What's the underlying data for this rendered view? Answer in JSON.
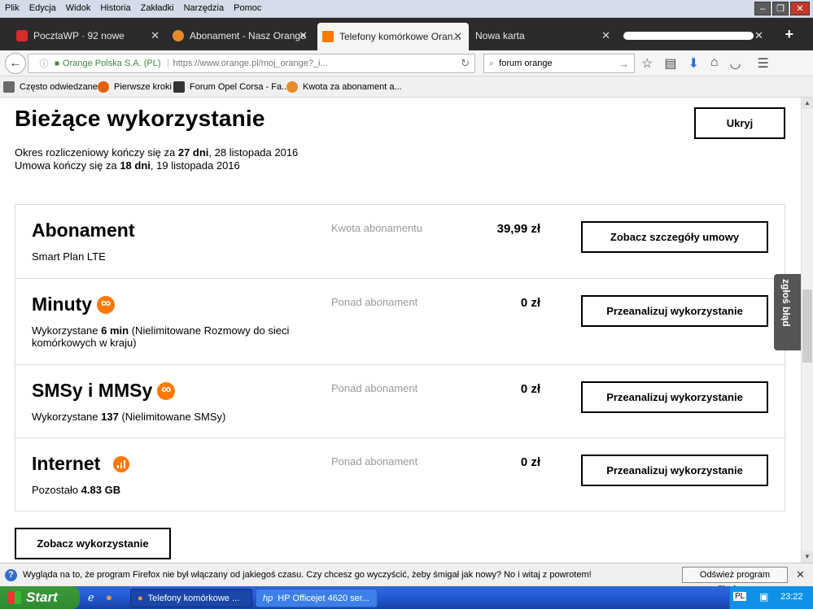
{
  "menubar": {
    "items": [
      "Plik",
      "Edycja",
      "Widok",
      "Historia",
      "Zakładki",
      "Narzędzia",
      "Pomoc"
    ]
  },
  "tabs": [
    {
      "label": "PocztaWP · 92 nowe",
      "icon_color": "#d82b2b",
      "icon": "wp-mail-icon"
    },
    {
      "label": "Abonament - Nasz Orange",
      "icon_color": "#e88a2a",
      "icon": "orange-forum-icon"
    },
    {
      "label": "Telefony komórkowe Oran...",
      "icon_color": "#ff7900",
      "icon": "orange-logo-icon"
    },
    {
      "label": "Nowa karta",
      "icon_color": "",
      "icon": ""
    },
    {
      "label": "",
      "icon_color": "",
      "icon": ""
    }
  ],
  "navbar": {
    "org": "Orange Polska S.A. (PL)",
    "url": "https://www.orange.pl/moj_orange?_i...",
    "search": "forum orange"
  },
  "bookmarks": [
    {
      "label": "Często odwiedzane",
      "icon_color": "#6a6a6a"
    },
    {
      "label": "Pierwsze kroki",
      "icon_color": "#e66000"
    },
    {
      "label": "Forum Opel Corsa - Fa...",
      "icon_color": "#333"
    },
    {
      "label": "Kwota za abonament a...",
      "icon_color": "#e88a2a"
    }
  ],
  "page": {
    "title": "Bieżące wykorzystanie",
    "hide_button": "Ukryj",
    "period_line1": {
      "pre": "Okres rozliczeniowy kończy się za ",
      "bold": "27 dni",
      "post": ", 28 listopada 2016"
    },
    "period_line2": {
      "pre": "Umowa kończy się za ",
      "bold": "18 dni",
      "post": ", 19 listopada 2016"
    },
    "rows": [
      {
        "title": "Abonament",
        "sub_pre": "Smart Plan LTE",
        "sub_bold": "",
        "sub_post": "",
        "label": "Kwota abonamentu",
        "value": "39,99 zł",
        "button": "Zobacz szczegóły umowy",
        "icon": ""
      },
      {
        "title": "Minuty",
        "sub_pre": "Wykorzystane ",
        "sub_bold": "6 min",
        "sub_post": " (Nielimitowane Rozmowy do sieci komórkowych w kraju)",
        "label": "Ponad abonament",
        "value": "0 zł",
        "button": "Przeanalizuj wykorzystanie",
        "icon": "infinity-icon"
      },
      {
        "title": "SMSy i MMSy",
        "sub_pre": "Wykorzystane ",
        "sub_bold": "137",
        "sub_post": " (Nielimitowane SMSy)",
        "label": "Ponad abonament",
        "value": "0 zł",
        "button": "Przeanalizuj wykorzystanie",
        "icon": "infinity-icon"
      },
      {
        "title": "Internet",
        "sub_pre": "Pozostało ",
        "sub_bold": "4.83 GB",
        "sub_post": "",
        "label": "Ponad abonament",
        "value": "0 zł",
        "button": "Przeanalizuj wykorzystanie",
        "icon": "signal-icon"
      }
    ],
    "bottom_button": "Zobacz wykorzystanie",
    "feedback": "zgłoś błąd"
  },
  "notification": {
    "message": "Wygląda na to, że program Firefox nie był włączany od jakiegoś czasu. Czy chcesz go wyczyścić, żeby śmigał jak nowy? No i witaj z powrotem!",
    "button": "Odśwież program Firefox..."
  },
  "taskbar": {
    "start": "Start",
    "tasks": [
      "Telefony komórkowe ...",
      "HP Officejet 4620 ser..."
    ],
    "lang": "PL",
    "time": "23:22"
  }
}
